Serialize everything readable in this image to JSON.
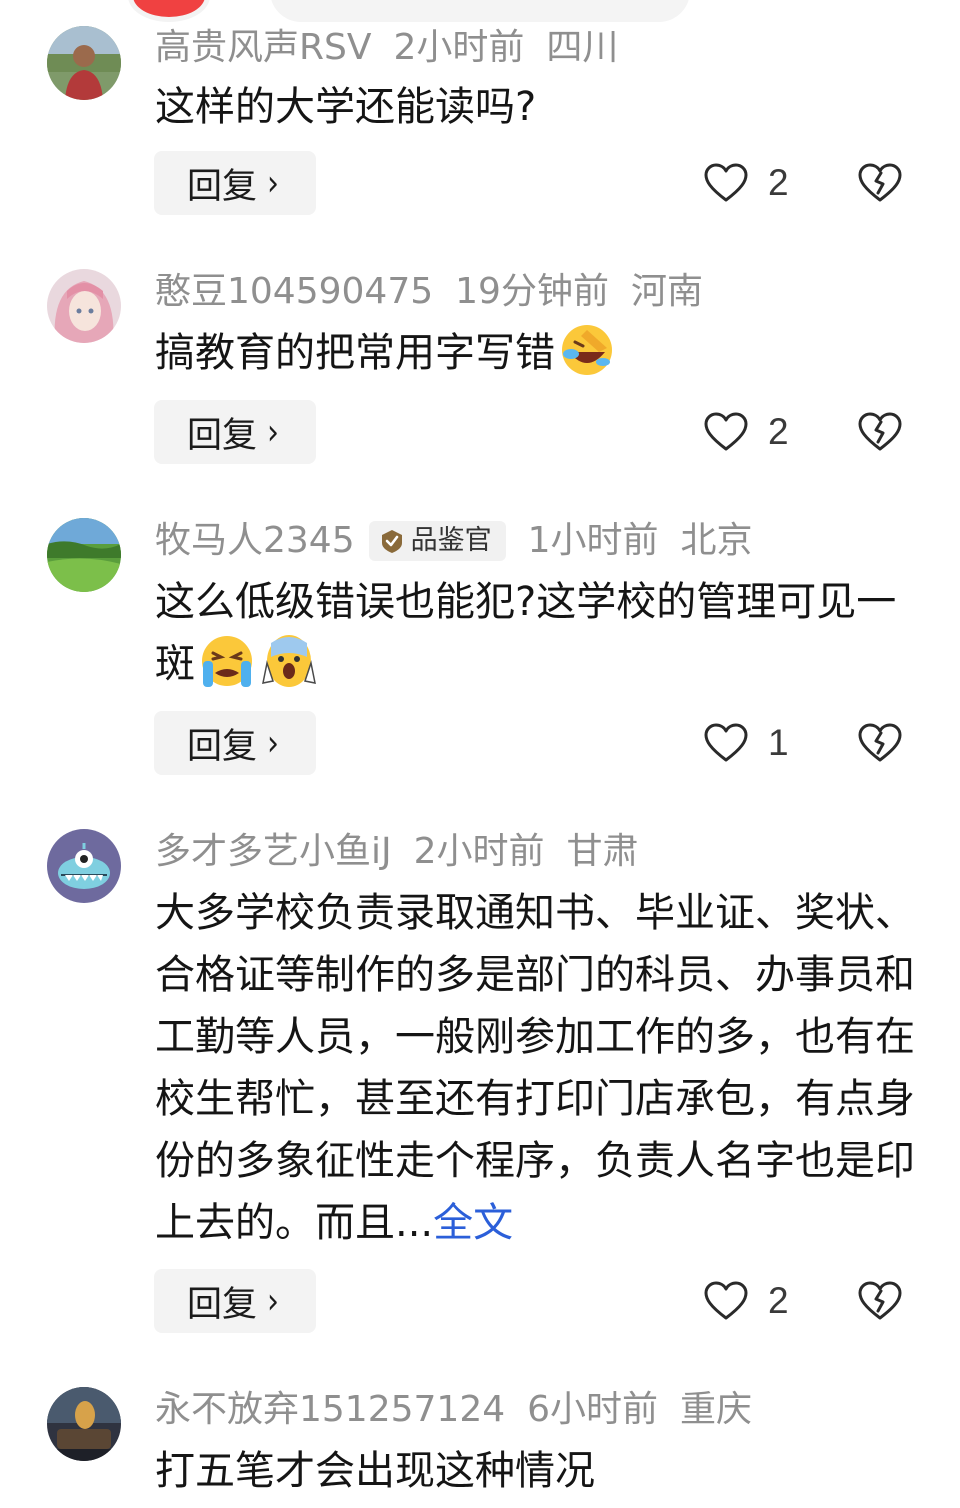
{
  "comments": [
    {
      "user": "高贵风声RSV",
      "time": "2小时前",
      "location": "四川",
      "text": "这样的大学还能读吗?",
      "more": "",
      "reply_label": "回复",
      "likes": "2",
      "badge": ""
    },
    {
      "user": "憨豆104590475",
      "time": "19分钟前",
      "location": "河南",
      "text": "搞教育的把常用字写错",
      "more": "",
      "reply_label": "回复",
      "likes": "2",
      "badge": "",
      "emojis": [
        "facepalm-laugh-emoji"
      ]
    },
    {
      "user": "牧马人2345",
      "time": "1小时前",
      "location": "北京",
      "badge": "品鉴官",
      "text": "这么低级错误也能犯?这学校的管理可见一斑",
      "more": "",
      "reply_label": "回复",
      "likes": "1",
      "emojis": [
        "crying-emoji",
        "shocked-emoji"
      ]
    },
    {
      "user": "多才多艺小鱼iJ",
      "time": "2小时前",
      "location": "甘肃",
      "text": "大多学校负责录取通知书、毕业证、奖状、合格证等制作的多是部门的科员、办事员和工勤等人员，一般刚参加工作的多，也有在校生帮忙，甚至还有打印门店承包，有点身份的多象征性走个程序，负责人名字也是印上去的。而且...",
      "more": "全文",
      "reply_label": "回复",
      "likes": "2",
      "badge": ""
    },
    {
      "user": "永不放弃151257124",
      "time": "6小时前",
      "location": "重庆",
      "text": "打五笔才会出现这种情况",
      "more": "",
      "reply_label": "回复",
      "likes": "",
      "badge": ""
    }
  ],
  "icons": {
    "like": "heart-outline-icon",
    "dislike": "broken-heart-icon",
    "badge": "verified-badge-icon",
    "chevron": "chevron-right-icon"
  },
  "colors": {
    "meta": "#8f8f8f",
    "text": "#151515",
    "link": "#2b5fd9",
    "button_bg": "#f3f3f3"
  }
}
